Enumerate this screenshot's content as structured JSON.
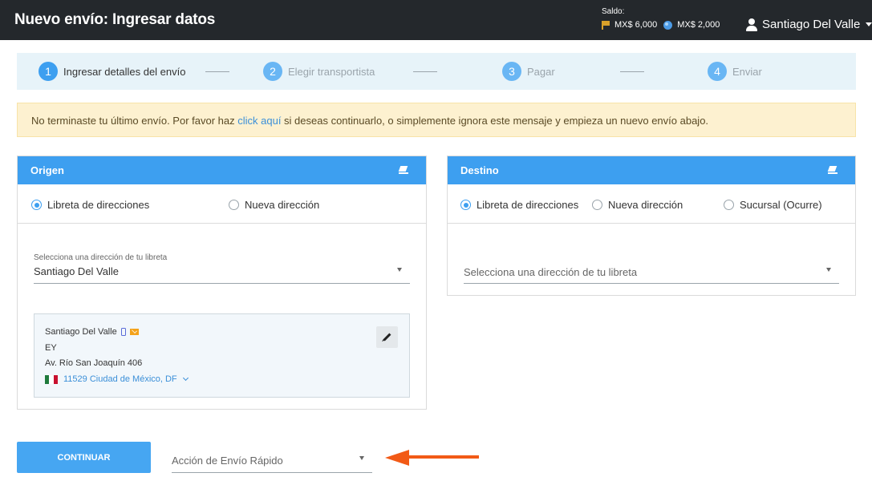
{
  "header": {
    "title": "Nuevo envío: Ingresar datos",
    "balance_label": "Saldo:",
    "balance_flag": "MX$ 6,000",
    "balance_globe": "MX$ 2,000",
    "user_name": "Santiago Del Valle"
  },
  "steps": [
    {
      "num": "1",
      "label": "Ingresar detalles del envío"
    },
    {
      "num": "2",
      "label": "Elegir transportista"
    },
    {
      "num": "3",
      "label": "Pagar"
    },
    {
      "num": "4",
      "label": "Enviar"
    }
  ],
  "alert": {
    "text_before": "No terminaste tu último envío. Por favor haz ",
    "link": "click aquí",
    "text_after": " si deseas continuarlo, o simplemente ignora este mensaje y empieza un nuevo envío abajo."
  },
  "origin": {
    "title": "Origen",
    "radio_book": "Libreta de direcciones",
    "radio_new": "Nueva dirección",
    "select_label": "Selecciona una dirección de tu libreta",
    "select_value": "Santiago Del Valle",
    "card": {
      "name": "Santiago Del Valle",
      "company": "EY",
      "street": "Av. Río San Joaquín 406",
      "city": "11529 Ciudad de México, DF"
    }
  },
  "destination": {
    "title": "Destino",
    "radio_book": "Libreta de direcciones",
    "radio_new": "Nueva dirección",
    "radio_branch": "Sucursal (Ocurre)",
    "select_placeholder": "Selecciona una dirección de tu libreta"
  },
  "footer": {
    "continue_label": "CONTINUAR",
    "quick_action_placeholder": "Acción de Envío Rápido"
  },
  "colors": {
    "header_bg": "#24282c",
    "accent": "#3d9ff0",
    "alert_bg": "#fdf1d0",
    "arrow": "#f25a16"
  }
}
